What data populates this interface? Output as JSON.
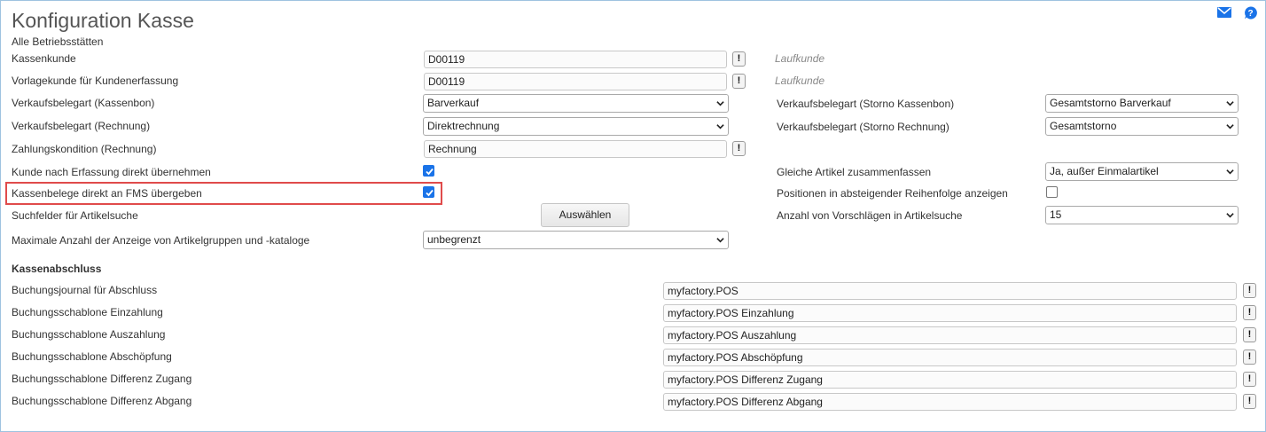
{
  "page": {
    "title": "Konfiguration Kasse",
    "subtitle": "Alle Betriebsstätten"
  },
  "header_icons": {
    "mail": "mail-icon",
    "help": "help-icon"
  },
  "form": {
    "kassenkunde": {
      "label": "Kassenkunde",
      "value": "D00119",
      "hint": "Laufkunde"
    },
    "vorlagekunde": {
      "label": "Vorlagekunde für Kundenerfassung",
      "value": "D00119",
      "hint": "Laufkunde"
    },
    "vk_kassenbon": {
      "label": "Verkaufsbelegart (Kassenbon)",
      "value": "Barverkauf"
    },
    "vk_rechnung": {
      "label": "Verkaufsbelegart (Rechnung)",
      "value": "Direktrechnung"
    },
    "zahlungskondition": {
      "label": "Zahlungskondition (Rechnung)",
      "value": "Rechnung"
    },
    "kunde_uebernehmen": {
      "label": "Kunde nach Erfassung direkt übernehmen",
      "checked": true
    },
    "fms_uebergeben": {
      "label": "Kassenbelege direkt an FMS übergeben",
      "checked": true
    },
    "suchfelder": {
      "label": "Suchfelder für Artikelsuche",
      "button": "Auswählen"
    },
    "max_anzeige": {
      "label": "Maximale Anzahl der Anzeige von Artikelgruppen und -kataloge",
      "value": "unbegrenzt"
    },
    "storno_kassenbon": {
      "label": "Verkaufsbelegart (Storno Kassenbon)",
      "value": "Gesamtstorno Barverkauf"
    },
    "storno_rechnung": {
      "label": "Verkaufsbelegart (Storno Rechnung)",
      "value": "Gesamtstorno"
    },
    "gleiche_artikel": {
      "label": "Gleiche Artikel zusammenfassen",
      "value": "Ja, außer Einmalartikel"
    },
    "absteigend": {
      "label": "Positionen in absteigender Reihenfolge anzeigen",
      "checked": false
    },
    "vorschlaege": {
      "label": "Anzahl von Vorschlägen in Artikelsuche",
      "value": "15"
    }
  },
  "kassenabschluss": {
    "heading": "Kassenabschluss",
    "rows": [
      {
        "label": "Buchungsjournal für Abschluss",
        "value": "myfactory.POS"
      },
      {
        "label": "Buchungsschablone Einzahlung",
        "value": "myfactory.POS Einzahlung"
      },
      {
        "label": "Buchungsschablone Auszahlung",
        "value": "myfactory.POS Auszahlung"
      },
      {
        "label": "Buchungsschablone Abschöpfung",
        "value": "myfactory.POS Abschöpfung"
      },
      {
        "label": "Buchungsschablone Differenz Zugang",
        "value": "myfactory.POS Differenz Zugang"
      },
      {
        "label": "Buchungsschablone Differenz Abgang",
        "value": "myfactory.POS Differenz Abgang"
      }
    ]
  },
  "lookup_button_text": "!",
  "colors": {
    "accent": "#1a73e8",
    "highlight": "#e04b4b",
    "title": "#555555"
  }
}
